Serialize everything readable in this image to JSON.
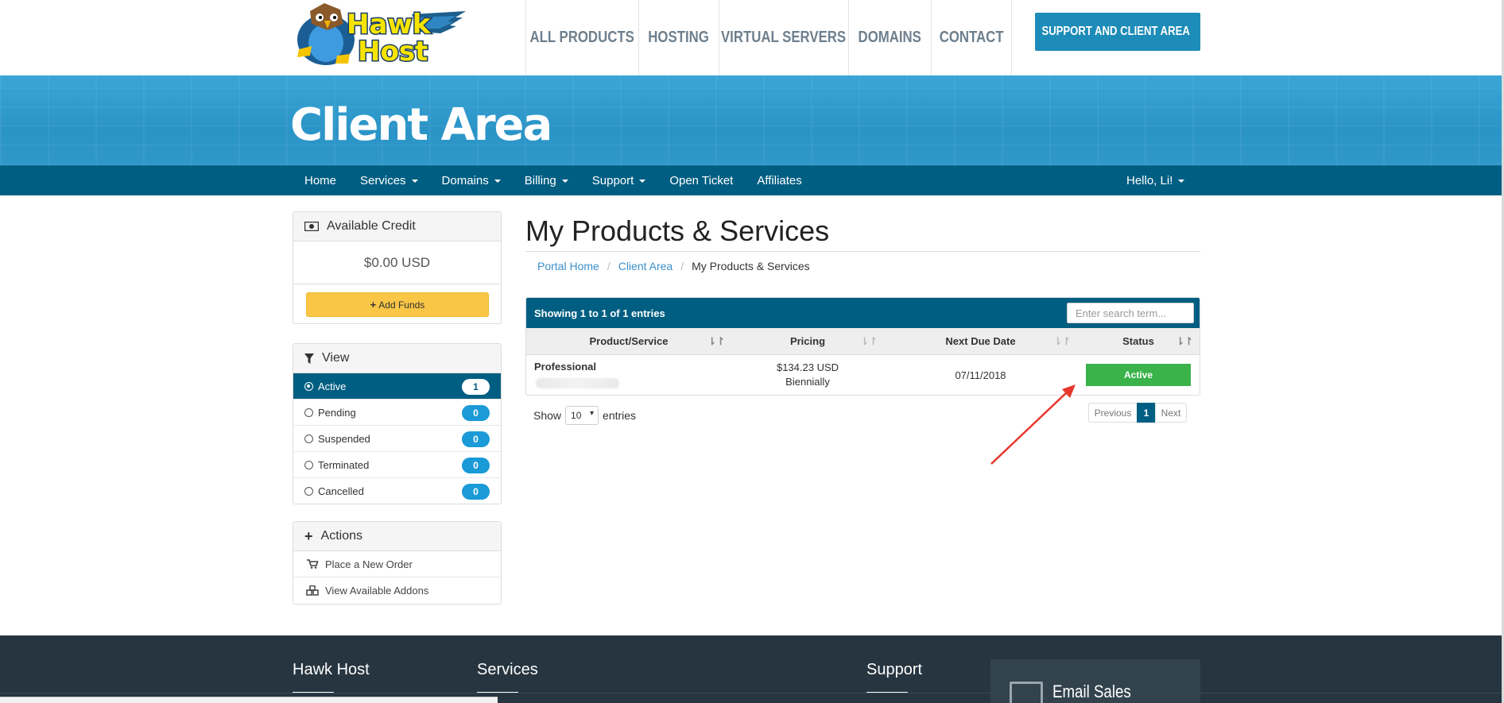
{
  "header": {
    "logo_text": "Hawk Host",
    "nav": [
      "ALL PRODUCTS",
      "HOSTING",
      "VIRTUAL SERVERS",
      "DOMAINS",
      "CONTACT"
    ],
    "support_button": "SUPPORT AND CLIENT AREA"
  },
  "banner": {
    "title": "Client Area"
  },
  "mainnav": {
    "items": [
      {
        "label": "Home",
        "dropdown": false
      },
      {
        "label": "Services",
        "dropdown": true
      },
      {
        "label": "Domains",
        "dropdown": true
      },
      {
        "label": "Billing",
        "dropdown": true
      },
      {
        "label": "Support",
        "dropdown": true
      },
      {
        "label": "Open Ticket",
        "dropdown": false
      },
      {
        "label": "Affiliates",
        "dropdown": false
      }
    ],
    "user": "Hello, Li!"
  },
  "sidebar": {
    "credit": {
      "title": "Available Credit",
      "amount": "$0.00 USD",
      "add_funds": "Add Funds"
    },
    "view": {
      "title": "View",
      "items": [
        {
          "label": "Active",
          "count": "1",
          "selected": true
        },
        {
          "label": "Pending",
          "count": "0",
          "selected": false
        },
        {
          "label": "Suspended",
          "count": "0",
          "selected": false
        },
        {
          "label": "Terminated",
          "count": "0",
          "selected": false
        },
        {
          "label": "Cancelled",
          "count": "0",
          "selected": false
        }
      ]
    },
    "actions": {
      "title": "Actions",
      "items": [
        "Place a New Order",
        "View Available Addons"
      ]
    }
  },
  "main": {
    "title": "My Products & Services",
    "breadcrumb": [
      "Portal Home",
      "Client Area",
      "My Products & Services"
    ],
    "table": {
      "info": "Showing 1 to 1 of 1 entries",
      "search_placeholder": "Enter search term...",
      "columns": [
        "Product/Service",
        "Pricing",
        "Next Due Date",
        "Status"
      ],
      "rows": [
        {
          "product": "Professional",
          "price": "$134.23 USD",
          "cycle": "Biennially",
          "due": "07/11/2018",
          "status": "Active"
        }
      ]
    },
    "show": {
      "label_before": "Show",
      "value": "10",
      "label_after": "entries"
    },
    "pager": {
      "prev": "Previous",
      "page": "1",
      "next": "Next"
    }
  },
  "footer": {
    "headings": [
      "Hawk Host",
      "Services",
      "Support"
    ],
    "email": "Email Sales"
  },
  "colors": {
    "navy": "#005e82",
    "accent": "#1e8cb8",
    "active_green": "#3ab34a",
    "funds_yellow": "#f9c646",
    "footer": "#263540"
  }
}
